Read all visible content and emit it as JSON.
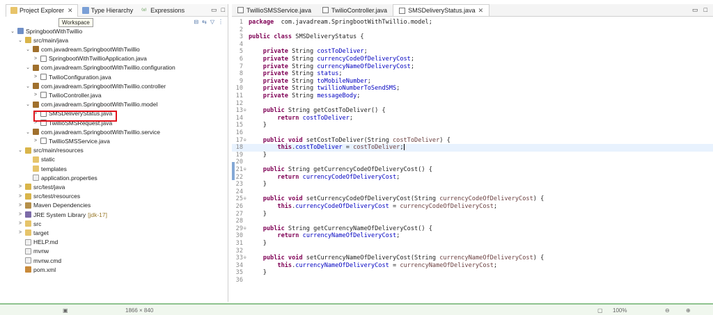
{
  "left_tabs": [
    {
      "label": "Project Explorer",
      "close": "✕"
    },
    {
      "label": "Type Hierarchy"
    },
    {
      "label": "Expressions"
    }
  ],
  "left_window_controls": [
    "▭",
    "□"
  ],
  "left_toolbar_icons": [
    "collapse-all-icon",
    "link-editor-icon",
    "filter-icon",
    "view-menu-icon"
  ],
  "tooltip": "Workspace",
  "tree": [
    {
      "label": "SpringbootWithTwillio",
      "arrow": "⌄",
      "indent": 0,
      "icon": "project"
    },
    {
      "label": "src/main/java",
      "arrow": "⌄",
      "indent": 1,
      "icon": "srcfolder"
    },
    {
      "label": "com.javadream.SpringbootWithTwillio",
      "arrow": "⌄",
      "indent": 2,
      "icon": "package"
    },
    {
      "label": "SpringbootWithTwillioApplication.java",
      "arrow": ">",
      "indent": 3,
      "icon": "java"
    },
    {
      "label": "com.javadream.SpringbootWithTwillio.configuration",
      "arrow": "⌄",
      "indent": 2,
      "icon": "package"
    },
    {
      "label": "TwilioConfiguration.java",
      "arrow": ">",
      "indent": 3,
      "icon": "java"
    },
    {
      "label": "com.javadream.SpringbootWithTwillio.controller",
      "arrow": "⌄",
      "indent": 2,
      "icon": "package"
    },
    {
      "label": "TwilioController.java",
      "arrow": ">",
      "indent": 3,
      "icon": "java"
    },
    {
      "label": "com.javadream.SpringbootWithTwillio.model",
      "arrow": "⌄",
      "indent": 2,
      "icon": "package"
    },
    {
      "label": "SMSDeliveryStatus.java",
      "arrow": ">",
      "indent": 3,
      "icon": "java",
      "selected": true
    },
    {
      "label": "TwillioSMSRequest.java",
      "arrow": ">",
      "indent": 3,
      "icon": "java"
    },
    {
      "label": "com.javadream.SpringbootWithTwillio.service",
      "arrow": "⌄",
      "indent": 2,
      "icon": "package"
    },
    {
      "label": "TwillioSMSService.java",
      "arrow": ">",
      "indent": 3,
      "icon": "java"
    },
    {
      "label": "src/main/resources",
      "arrow": "⌄",
      "indent": 1,
      "icon": "srcfolder"
    },
    {
      "label": "static",
      "arrow": "",
      "indent": 2,
      "icon": "folder"
    },
    {
      "label": "templates",
      "arrow": "",
      "indent": 2,
      "icon": "folder"
    },
    {
      "label": "application.properties",
      "arrow": "",
      "indent": 2,
      "icon": "file"
    },
    {
      "label": "src/test/java",
      "arrow": ">",
      "indent": 1,
      "icon": "srcfolder"
    },
    {
      "label": "src/test/resources",
      "arrow": ">",
      "indent": 1,
      "icon": "srcfolder"
    },
    {
      "label": "Maven Dependencies",
      "arrow": ">",
      "indent": 1,
      "icon": "lib"
    },
    {
      "label": "JRE System Library",
      "sub": " [jdk-17]",
      "arrow": ">",
      "indent": 1,
      "icon": "jre"
    },
    {
      "label": "src",
      "arrow": ">",
      "indent": 1,
      "icon": "folder"
    },
    {
      "label": "target",
      "arrow": ">",
      "indent": 1,
      "icon": "folder"
    },
    {
      "label": "HELP.md",
      "arrow": "",
      "indent": 1,
      "icon": "file"
    },
    {
      "label": "mvnw",
      "arrow": "",
      "indent": 1,
      "icon": "file"
    },
    {
      "label": "mvnw.cmd",
      "arrow": "",
      "indent": 1,
      "icon": "file"
    },
    {
      "label": "pom.xml",
      "arrow": "",
      "indent": 1,
      "icon": "xml"
    }
  ],
  "editor_tabs": [
    {
      "label": "TwillioSMSService.java"
    },
    {
      "label": "TwilioController.java"
    },
    {
      "label": "SMSDeliveryStatus.java",
      "close": "✕",
      "active": true
    }
  ],
  "editor_window_controls": [
    "▭",
    "□"
  ],
  "code_lines": [
    {
      "n": "1",
      "tokens": [
        [
          "kw",
          "package"
        ],
        [
          "",
          "  com.javadream.SpringbootWithTwillio.model;"
        ]
      ]
    },
    {
      "n": "2",
      "tokens": []
    },
    {
      "n": "3",
      "tokens": [
        [
          "kw",
          "public class"
        ],
        [
          "",
          " SMSDeliveryStatus {"
        ]
      ]
    },
    {
      "n": "4",
      "tokens": []
    },
    {
      "n": "5",
      "tokens": [
        [
          "",
          "    "
        ],
        [
          "kw",
          "private"
        ],
        [
          "",
          " String "
        ],
        [
          "fld",
          "costToDeliver"
        ],
        [
          "",
          ";"
        ]
      ]
    },
    {
      "n": "6",
      "tokens": [
        [
          "",
          "    "
        ],
        [
          "kw",
          "private"
        ],
        [
          "",
          " String "
        ],
        [
          "fld",
          "currencyCodeOfDeliveryCost"
        ],
        [
          "",
          ";"
        ]
      ]
    },
    {
      "n": "7",
      "tokens": [
        [
          "",
          "    "
        ],
        [
          "kw",
          "private"
        ],
        [
          "",
          " String "
        ],
        [
          "fld",
          "currencyNameOfDeliveryCost"
        ],
        [
          "",
          ";"
        ]
      ]
    },
    {
      "n": "8",
      "tokens": [
        [
          "",
          "    "
        ],
        [
          "kw",
          "private"
        ],
        [
          "",
          " String "
        ],
        [
          "fld",
          "status"
        ],
        [
          "",
          ";"
        ]
      ]
    },
    {
      "n": "9",
      "tokens": [
        [
          "",
          "    "
        ],
        [
          "kw",
          "private"
        ],
        [
          "",
          " String "
        ],
        [
          "fld",
          "toMobileNumber"
        ],
        [
          "",
          ";"
        ]
      ]
    },
    {
      "n": "10",
      "tokens": [
        [
          "",
          "    "
        ],
        [
          "kw",
          "private"
        ],
        [
          "",
          " String "
        ],
        [
          "fld",
          "twillioNumberToSendSMS"
        ],
        [
          "",
          ";"
        ]
      ]
    },
    {
      "n": "11",
      "tokens": [
        [
          "",
          "    "
        ],
        [
          "kw",
          "private"
        ],
        [
          "",
          " String "
        ],
        [
          "fld",
          "messageBody"
        ],
        [
          "",
          ";"
        ]
      ]
    },
    {
      "n": "12",
      "tokens": []
    },
    {
      "n": "13",
      "fold": "⊖",
      "tokens": [
        [
          "",
          "    "
        ],
        [
          "kw",
          "public"
        ],
        [
          "",
          " String getCostToDeliver() {"
        ]
      ]
    },
    {
      "n": "14",
      "tokens": [
        [
          "",
          "        "
        ],
        [
          "kw",
          "return"
        ],
        [
          "",
          " "
        ],
        [
          "fld",
          "costToDeliver"
        ],
        [
          "",
          ";"
        ]
      ]
    },
    {
      "n": "15",
      "tokens": [
        [
          "",
          "    }"
        ]
      ]
    },
    {
      "n": "16",
      "tokens": []
    },
    {
      "n": "17",
      "fold": "⊖",
      "tokens": [
        [
          "",
          "    "
        ],
        [
          "kw",
          "public void"
        ],
        [
          "",
          " setCostToDeliver(String "
        ],
        [
          "par",
          "costToDeliver"
        ],
        [
          "",
          ") {"
        ]
      ]
    },
    {
      "n": "18",
      "current": true,
      "tokens": [
        [
          "",
          "        "
        ],
        [
          "kw",
          "this"
        ],
        [
          "",
          "."
        ],
        [
          "fld",
          "costToDeliver"
        ],
        [
          "",
          " = "
        ],
        [
          "par",
          "costToDeliver"
        ],
        [
          "",
          ";"
        ]
      ]
    },
    {
      "n": "19",
      "tokens": [
        [
          "",
          "    }"
        ]
      ]
    },
    {
      "n": "20",
      "tokens": []
    },
    {
      "n": "21",
      "fold": "⊖",
      "tokens": [
        [
          "",
          "    "
        ],
        [
          "kw",
          "public"
        ],
        [
          "",
          " String getCurrencyCodeOfDeliveryCost() {"
        ]
      ]
    },
    {
      "n": "22",
      "tokens": [
        [
          "",
          "        "
        ],
        [
          "kw",
          "return"
        ],
        [
          "",
          " "
        ],
        [
          "fld",
          "currencyCodeOfDeliveryCost"
        ],
        [
          "",
          ";"
        ]
      ]
    },
    {
      "n": "23",
      "tokens": [
        [
          "",
          "    }"
        ]
      ]
    },
    {
      "n": "24",
      "tokens": []
    },
    {
      "n": "25",
      "fold": "⊖",
      "tokens": [
        [
          "",
          "    "
        ],
        [
          "kw",
          "public void"
        ],
        [
          "",
          " setCurrencyCodeOfDeliveryCost(String "
        ],
        [
          "par",
          "currencyCodeOfDeliveryCost"
        ],
        [
          "",
          ") {"
        ]
      ]
    },
    {
      "n": "26",
      "tokens": [
        [
          "",
          "        "
        ],
        [
          "kw",
          "this"
        ],
        [
          "",
          "."
        ],
        [
          "fld",
          "currencyCodeOfDeliveryCost"
        ],
        [
          "",
          " = "
        ],
        [
          "par",
          "currencyCodeOfDeliveryCost"
        ],
        [
          "",
          ";"
        ]
      ]
    },
    {
      "n": "27",
      "tokens": [
        [
          "",
          "    }"
        ]
      ]
    },
    {
      "n": "28",
      "tokens": []
    },
    {
      "n": "29",
      "fold": "⊖",
      "tokens": [
        [
          "",
          "    "
        ],
        [
          "kw",
          "public"
        ],
        [
          "",
          " String getCurrencyNameOfDeliveryCost() {"
        ]
      ]
    },
    {
      "n": "30",
      "tokens": [
        [
          "",
          "        "
        ],
        [
          "kw",
          "return"
        ],
        [
          "",
          " "
        ],
        [
          "fld",
          "currencyNameOfDeliveryCost"
        ],
        [
          "",
          ";"
        ]
      ]
    },
    {
      "n": "31",
      "tokens": [
        [
          "",
          "    }"
        ]
      ]
    },
    {
      "n": "32",
      "tokens": []
    },
    {
      "n": "33",
      "fold": "⊖",
      "tokens": [
        [
          "",
          "    "
        ],
        [
          "kw",
          "public void"
        ],
        [
          "",
          " setCurrencyNameOfDeliveryCost(String "
        ],
        [
          "par",
          "currencyNameOfDeliveryCost"
        ],
        [
          "",
          ") {"
        ]
      ]
    },
    {
      "n": "34",
      "tokens": [
        [
          "",
          "        "
        ],
        [
          "kw",
          "this"
        ],
        [
          "",
          "."
        ],
        [
          "fld",
          "currencyNameOfDeliveryCost"
        ],
        [
          "",
          " = "
        ],
        [
          "par",
          "currencyNameOfDeliveryCost"
        ],
        [
          "",
          ";"
        ]
      ]
    },
    {
      "n": "35",
      "tokens": [
        [
          "",
          "    }"
        ]
      ]
    },
    {
      "n": "36",
      "tokens": []
    }
  ],
  "colors": {
    "selection_border": "#e0121b",
    "keyword": "#7f0055",
    "field": "#0000c0",
    "status_bar_border": "#8fc38f"
  },
  "status_bar": {
    "left": "1866 × 840",
    "zoom": "100%"
  }
}
